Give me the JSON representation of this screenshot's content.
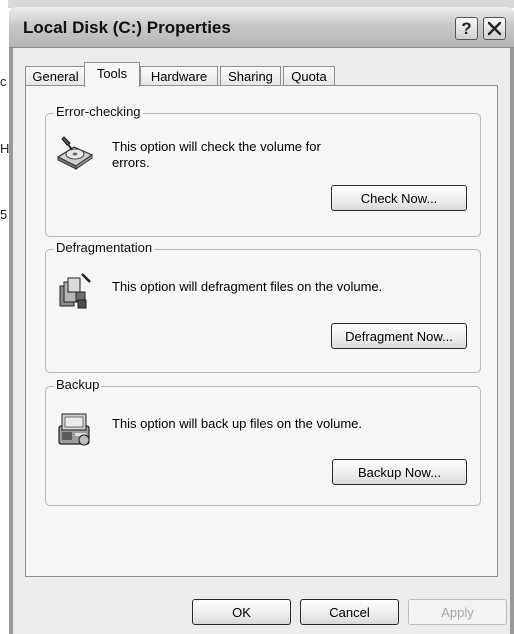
{
  "window": {
    "title": "Local Disk (C:) Properties",
    "help_glyph": "?",
    "close_glyph": "✕"
  },
  "background_glyphs": [
    "c",
    "H",
    "5"
  ],
  "tabs": [
    {
      "label": "General",
      "active": false
    },
    {
      "label": "Tools",
      "active": true
    },
    {
      "label": "Hardware",
      "active": false
    },
    {
      "label": "Sharing",
      "active": false
    },
    {
      "label": "Quota",
      "active": false
    }
  ],
  "groups": {
    "error_checking": {
      "title": "Error-checking",
      "line1": "This option will check the volume for",
      "line2": "errors.",
      "button": "Check Now...",
      "icon": "disk-check-icon"
    },
    "defragmentation": {
      "title": "Defragmentation",
      "line1": "This option will defragment files on the volume.",
      "button": "Defragment Now...",
      "icon": "defragment-icon"
    },
    "backup": {
      "title": "Backup",
      "line1": "This option will back up files on the volume.",
      "button": "Backup Now...",
      "icon": "backup-icon"
    }
  },
  "footer": {
    "ok": "OK",
    "cancel": "Cancel",
    "apply": "Apply",
    "apply_enabled": false
  }
}
